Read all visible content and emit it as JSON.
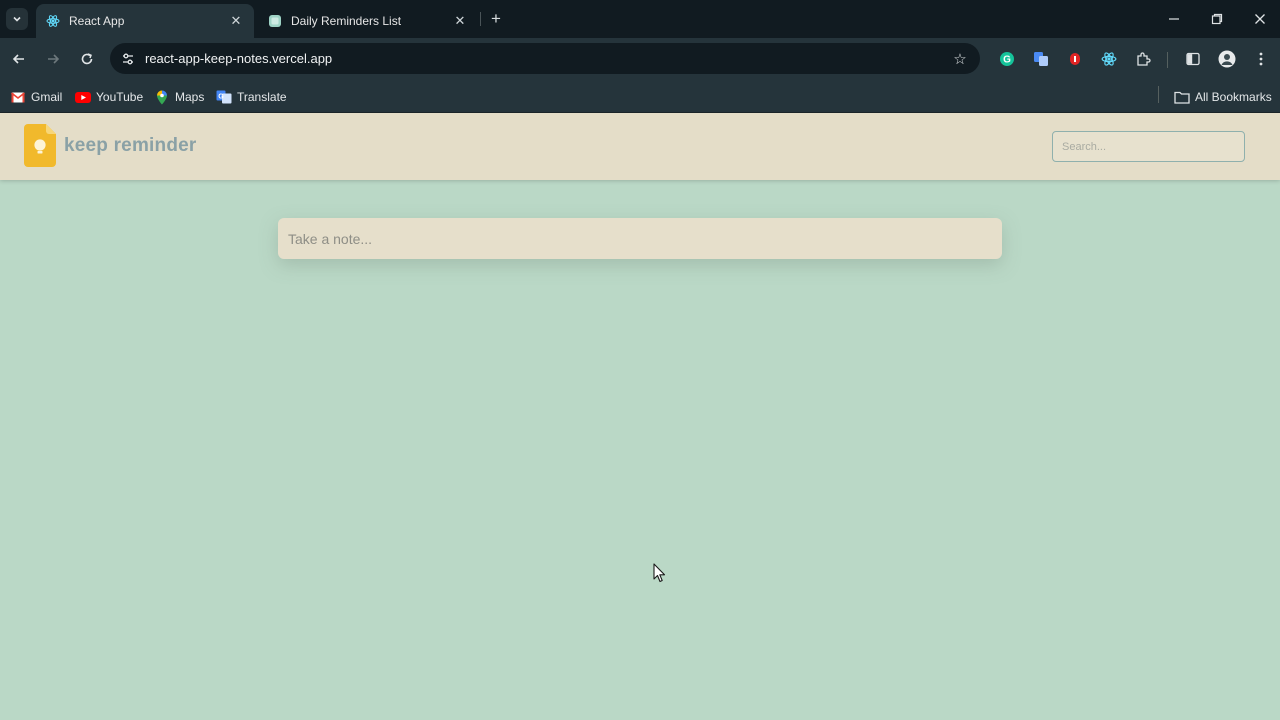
{
  "browser": {
    "tabs": [
      {
        "title": "React App",
        "active": true
      },
      {
        "title": "Daily Reminders List",
        "active": false
      }
    ],
    "url": "react-app-keep-notes.vercel.app",
    "bookmarks": [
      {
        "label": "Gmail",
        "icon": "gmail-icon"
      },
      {
        "label": "YouTube",
        "icon": "youtube-icon"
      },
      {
        "label": "Maps",
        "icon": "maps-icon"
      },
      {
        "label": "Translate",
        "icon": "translate-icon"
      }
    ],
    "all_bookmarks_label": "All Bookmarks"
  },
  "app": {
    "brand": "keep reminder",
    "search_placeholder": "Search...",
    "note_placeholder": "Take a note..."
  },
  "colors": {
    "page_background": "#bad8c6",
    "header_background": "#e4ddc8",
    "brand_text": "#8aa1a6",
    "logo_yellow": "#f1b92c"
  }
}
